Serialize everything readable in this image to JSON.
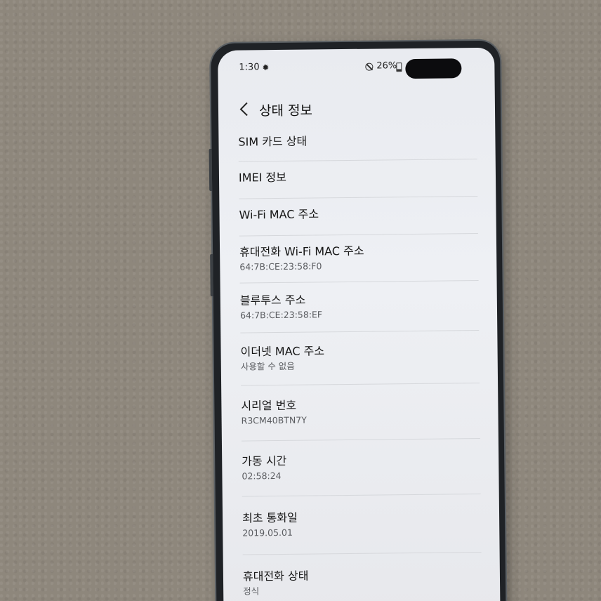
{
  "statusbar": {
    "time": "1:30",
    "battery": "26%",
    "icons": [
      "gear-icon",
      "do-not-disturb-icon",
      "battery-icon"
    ]
  },
  "header": {
    "back_icon": "chevron-left-icon",
    "title": "상태 정보"
  },
  "items": [
    {
      "title": "SIM 카드 상태",
      "value": ""
    },
    {
      "title": "IMEI 정보",
      "value": ""
    },
    {
      "title": "Wi-Fi MAC 주소",
      "value": ""
    },
    {
      "title": "휴대전화 Wi-Fi MAC 주소",
      "value": "64:7B:CE:23:58:F0"
    },
    {
      "title": "블루투스 주소",
      "value": "64:7B:CE:23:58:EF"
    },
    {
      "title": "이더넷 MAC 주소",
      "value": "사용할 수 없음"
    },
    {
      "title": "시리얼 번호",
      "value": "R3CM40BTN7Y"
    },
    {
      "title": "가동 시간",
      "value": "02:58:24"
    },
    {
      "title": "최초 통화일",
      "value": "2019.05.01"
    },
    {
      "title": "휴대전화 상태",
      "value": "정식"
    }
  ],
  "colors": {
    "screen_background": "#eceef2",
    "text_primary": "#161616",
    "text_secondary": "#5a5c60",
    "desk_background": "#8e877c"
  }
}
